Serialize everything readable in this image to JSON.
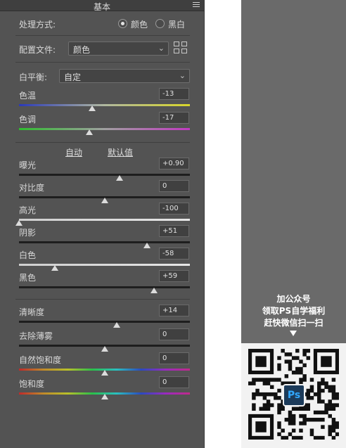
{
  "panel": {
    "title": "基本",
    "treatment": {
      "label": "处理方式:",
      "options": [
        "颜色",
        "黑白"
      ],
      "selected": "颜色"
    },
    "profile": {
      "label": "配置文件:",
      "value": "颜色"
    },
    "white_balance": {
      "label": "白平衡:",
      "value": "自定"
    },
    "auto_label": "自动",
    "default_label": "默认值",
    "sliders": [
      {
        "label": "色温",
        "value": "-13",
        "position": 0.43,
        "track": "temperature"
      },
      {
        "label": "色调",
        "value": "-17",
        "position": 0.41,
        "track": "tint"
      },
      {
        "label": "曝光",
        "value": "+0.90",
        "position": 0.59,
        "track": "dark"
      },
      {
        "label": "对比度",
        "value": "0",
        "position": 0.5,
        "track": "dark"
      },
      {
        "label": "高光",
        "value": "-100",
        "position": 0.0,
        "track": "light"
      },
      {
        "label": "阴影",
        "value": "+51",
        "position": 0.75,
        "track": "dark"
      },
      {
        "label": "白色",
        "value": "-58",
        "position": 0.21,
        "track": "light"
      },
      {
        "label": "黑色",
        "value": "+59",
        "position": 0.79,
        "track": "dark"
      },
      {
        "label": "清晰度",
        "value": "+14",
        "position": 0.57,
        "track": "dark"
      },
      {
        "label": "去除薄雾",
        "value": "0",
        "position": 0.5,
        "track": "dark"
      },
      {
        "label": "自然饱和度",
        "value": "0",
        "position": 0.5,
        "track": "spectrum"
      },
      {
        "label": "饱和度",
        "value": "0",
        "position": 0.5,
        "track": "spectrum"
      }
    ]
  },
  "promo": {
    "line1": "加公众号",
    "line2": "领取PS自学福利",
    "line3": "赶快微信扫一扫",
    "badge": "Ps"
  },
  "colors": {
    "panel_bg": "#535353",
    "header_bg": "#3f3f3f",
    "promo_bg": "#6a6a6a"
  }
}
